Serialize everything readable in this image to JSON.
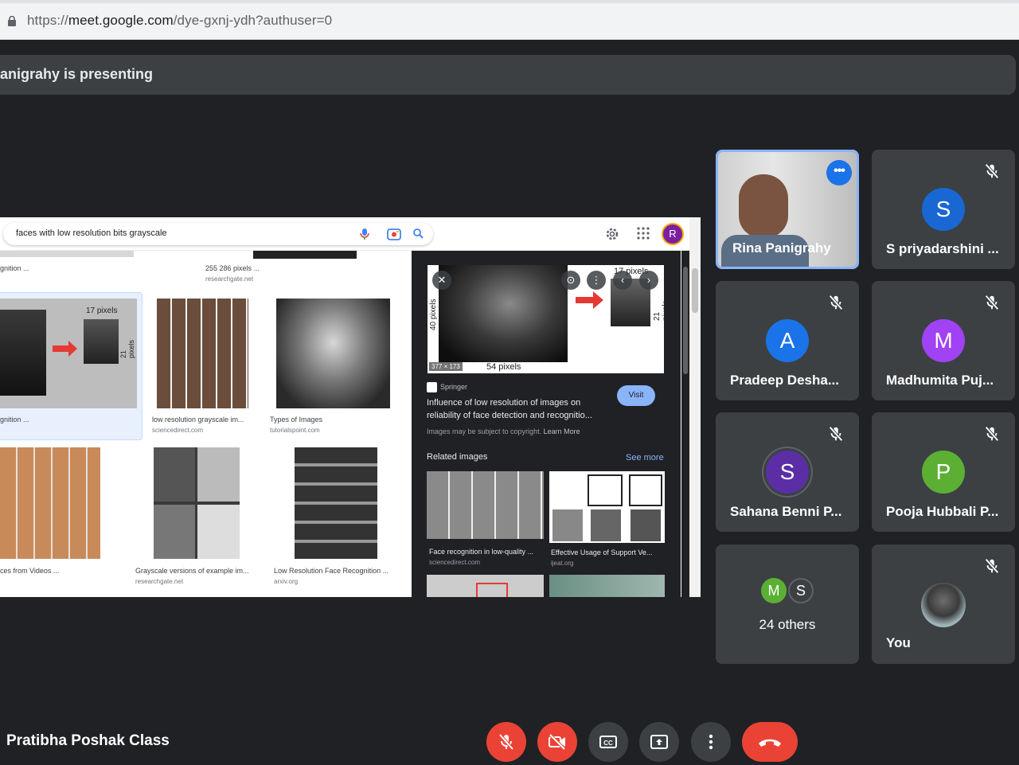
{
  "browser": {
    "url_scheme": "https://",
    "url_host": "meet.google.com",
    "url_path": "/dye-gxnj-ydh?authuser=0"
  },
  "banner": {
    "text": "anigrahy is presenting"
  },
  "shared_screen": {
    "search_query": "faces with low resolution bits grayscale",
    "account_initial": "R",
    "results": [
      {
        "caption": "gnition ...",
        "source": ""
      },
      {
        "caption": "255 286 pixels ...",
        "source": "researchgate.net"
      },
      {
        "caption": "gnition ...",
        "source": ""
      },
      {
        "caption": "low resolution grayscale im...",
        "source": "sciencedirect.com"
      },
      {
        "caption": "Types of Images",
        "source": "tutorialspoint.com"
      },
      {
        "caption": "ces from Videos ...",
        "source": ""
      },
      {
        "caption": "Grayscale versions of example im...",
        "source": "researchgate.net"
      },
      {
        "caption": "Low Resolution Face Recognition ...",
        "source": "arxiv.org"
      }
    ],
    "selected_thumb": {
      "pixels_label": "17 pixels",
      "side_label": "21 pixels"
    },
    "preview": {
      "top_label": "17 pixels",
      "left_label": "40 pixels",
      "right_label": "21 pixels",
      "bottom_label": "54 pixels",
      "dims": "377 × 173",
      "site": "Springer",
      "title_line1": "Influence of low resolution of images on",
      "title_line2": "reliability of face detection and recognitio...",
      "visit_label": "Visit",
      "copyright": "Images may be subject to copyright.",
      "learn_more": "Learn More",
      "related_label": "Related images",
      "see_more": "See more",
      "related": [
        {
          "caption": "Face recognition in low-quality ...",
          "source": "sciencedirect.com"
        },
        {
          "caption": "Effective Usage of Support Ve...",
          "source": "ijeat.org"
        }
      ]
    }
  },
  "participants": [
    {
      "name": "Rina Panigrahy",
      "type": "video",
      "muted": false,
      "active": true
    },
    {
      "name": "S priyadarshini ...",
      "initial": "S",
      "color": "#1967d2",
      "muted": true
    },
    {
      "name": "Pradeep Desha...",
      "initial": "A",
      "color": "#1a73e8",
      "muted": true
    },
    {
      "name": "Madhumita Puj...",
      "initial": "M",
      "color": "#a142f4",
      "muted": true
    },
    {
      "name": "Sahana Benni P...",
      "initial": "S",
      "color": "#5b2ea6",
      "muted": true
    },
    {
      "name": "Pooja Hubbali P...",
      "initial": "P",
      "color": "#5bb033",
      "muted": true
    },
    {
      "name": "24 others",
      "initials": [
        "M",
        "S"
      ],
      "colors": [
        "#5bb033",
        "#3c4043"
      ]
    },
    {
      "name": "You",
      "type": "photo",
      "muted": true
    }
  ],
  "meeting": {
    "name": "Pratibha Poshak Class"
  },
  "controls": [
    "mic-off",
    "camera-off",
    "captions",
    "present",
    "more",
    "end-call"
  ]
}
